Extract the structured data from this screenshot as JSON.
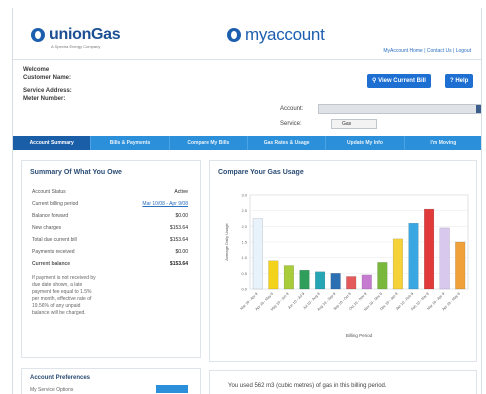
{
  "header": {
    "brand": "unionGas",
    "brand_sub": "A Spectra Energy Company",
    "app_title": "myaccount",
    "top_links": "MyAccount Home | Contact Us | Logout"
  },
  "customer": {
    "welcome": "Welcome",
    "customer_name_label": "Customer Name:",
    "service_address_label": "Service Address:",
    "meter_number_label": "Meter Number:"
  },
  "buttons": {
    "view_current_bill": "View Current Bill",
    "help": "Help"
  },
  "selectors": {
    "account_label": "Account:",
    "account_value": "",
    "service_label": "Service:",
    "service_value": "Gas"
  },
  "nav": {
    "tabs": [
      {
        "label": "Account Summary",
        "active": true
      },
      {
        "label": "Bills & Payments",
        "active": false
      },
      {
        "label": "Compare My Bills",
        "active": false
      },
      {
        "label": "Gas Rates & Usage",
        "active": false
      },
      {
        "label": "Update My Info",
        "active": false
      },
      {
        "label": "I'm Moving",
        "active": false
      }
    ]
  },
  "summary": {
    "title": "Summary Of What You Owe",
    "rows": [
      {
        "label": "Account Status",
        "value": "Active",
        "bold": false,
        "link": false
      },
      {
        "label": "Current billing period",
        "value": "Mar 10/08 - Apr 9/08",
        "bold": false,
        "link": true
      },
      {
        "label": "Balance forward",
        "value": "$0.00",
        "bold": false,
        "link": false
      },
      {
        "label": "New charges",
        "value": "$153.64",
        "bold": false,
        "link": false
      },
      {
        "label": "Total due current bill",
        "value": "$153.64",
        "bold": false,
        "link": false
      },
      {
        "label": "Payments received",
        "value": "$0.00",
        "bold": false,
        "link": false
      },
      {
        "label": "Current balance",
        "value": "$153.64",
        "bold": true,
        "link": false
      }
    ],
    "note": "If payment is not received by due date shown, a late payment fee equal to 1.5% per month, effective rate of 19.56% of any unpaid balance will be charged."
  },
  "usage_panel": {
    "title": "Compare Your Gas Usage"
  },
  "chart_data": {
    "type": "bar",
    "title": "",
    "xlabel": "Billing Period",
    "ylabel": "Average Daily Usage",
    "ylim": [
      0,
      3
    ],
    "y_ticks": [
      "0.0",
      "0.5",
      "1.0",
      "1.5",
      "2.0",
      "2.5",
      "3.0"
    ],
    "categories": [
      "Mar 10 - Apr 9",
      "Apr 10 - May 9",
      "May 10 - Jun 9",
      "Jun 10 - Jul 9",
      "Jul 10 - Aug 9",
      "Aug 10 - Sep 9",
      "Sep 10 - Oct 9",
      "Oct 10 - Nov 9",
      "Nov 10 - Dec 9",
      "Dec 10 - Jan 9",
      "Jan 10 - Feb 9",
      "Feb 10 - Mar 9",
      "Mar 10 - Apr 9",
      "Apr 10 - May 9"
    ],
    "values": [
      2.25,
      0.9,
      0.75,
      0.6,
      0.55,
      0.5,
      0.4,
      0.45,
      0.85,
      1.6,
      2.1,
      2.55,
      1.95,
      1.5
    ],
    "colors": [
      "#e8f2fb",
      "#f2d21b",
      "#a9cc3a",
      "#2f9e5a",
      "#26a6b5",
      "#2d6fb3",
      "#e45a5a",
      "#c47bd0",
      "#79b83c",
      "#f5d23a",
      "#3aa6e2",
      "#e03a3a",
      "#d9c8ee",
      "#f0a13a"
    ],
    "grid": true
  },
  "preferences": {
    "title": "Account Preferences",
    "row_label": "My Service Options"
  },
  "usage_text": "You used 562 m3 (cubic metres) of gas in this billing period."
}
